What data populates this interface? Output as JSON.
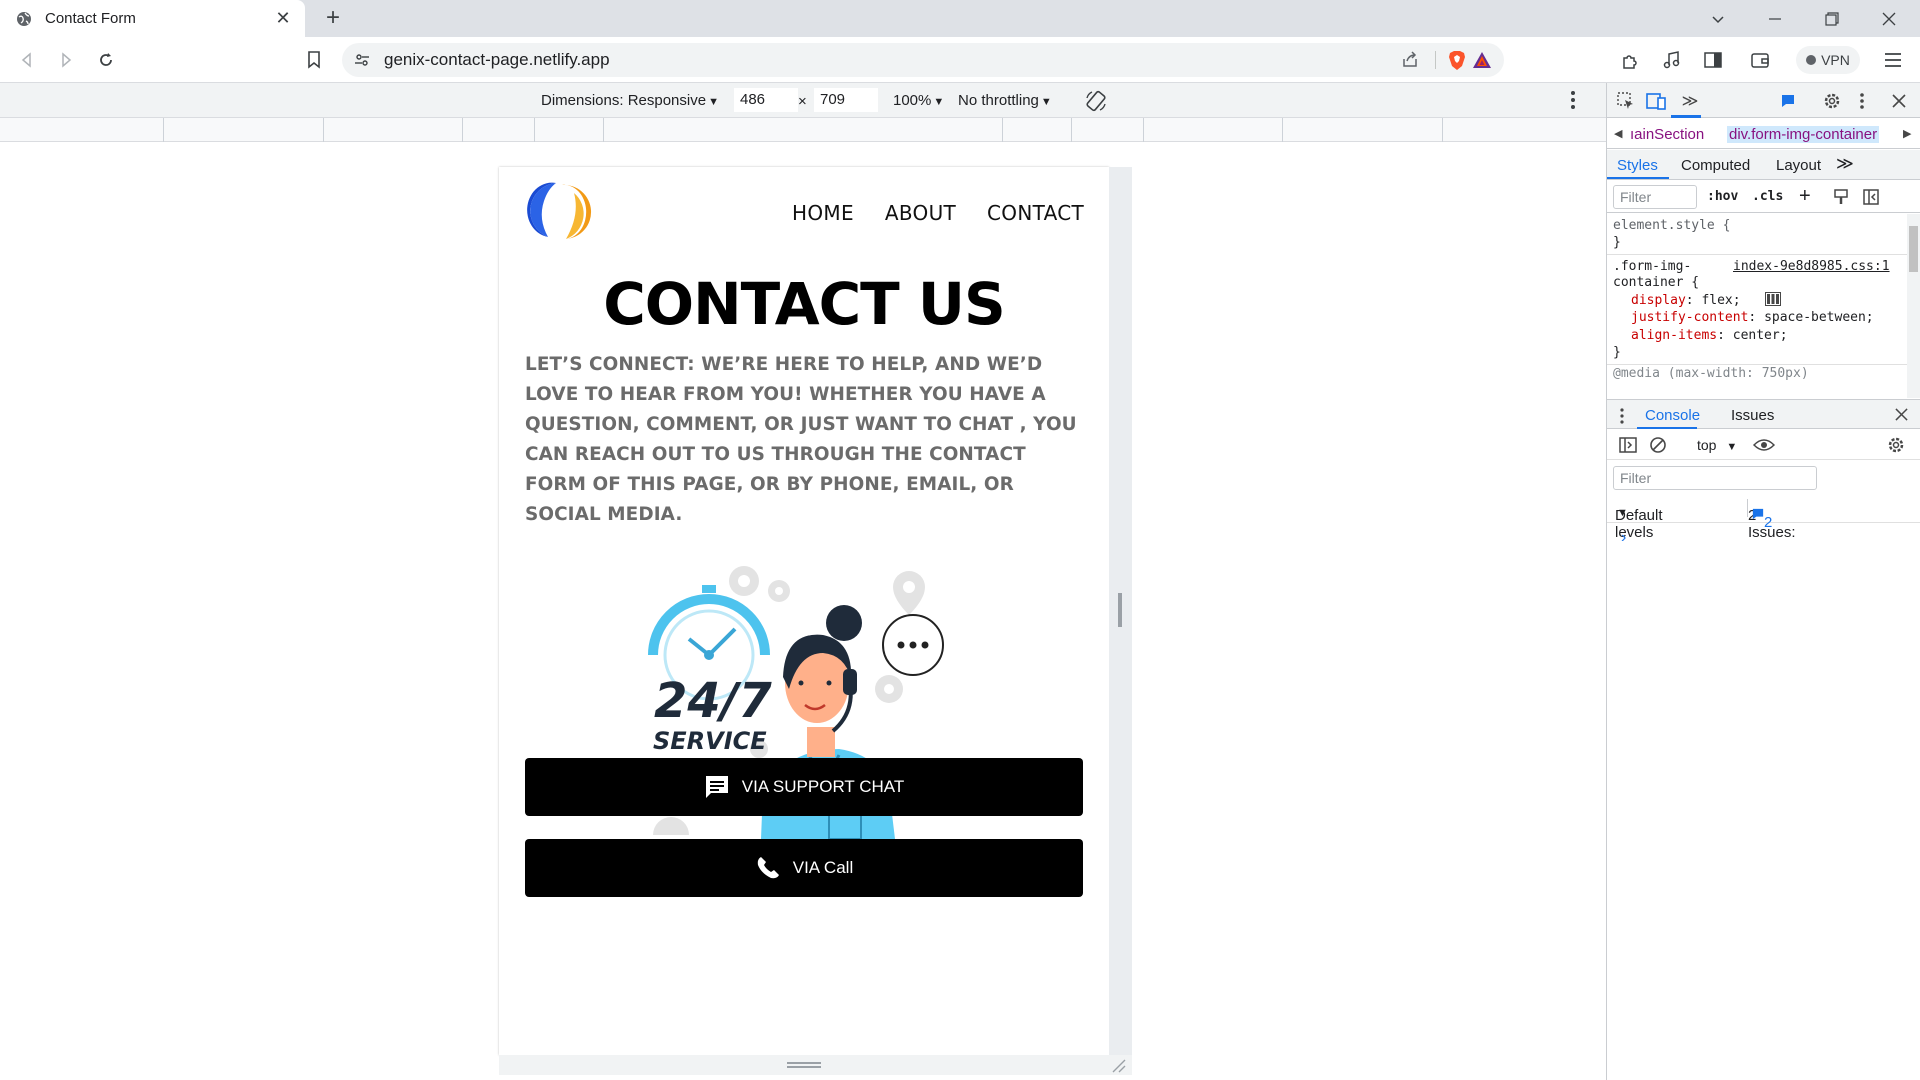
{
  "browser": {
    "tab_title": "Contact Form",
    "tab_close": "✕",
    "new_tab": "+",
    "url": "genix-contact-page.netlify.app",
    "vpn_label": "VPN"
  },
  "device_toolbar": {
    "dimensions_label": "Dimensions: Responsive",
    "width": "486",
    "times": "×",
    "height": "709",
    "zoom": "100%",
    "throttling": "No throttling"
  },
  "page": {
    "nav": [
      "HOME",
      "ABOUT",
      "CONTACT"
    ],
    "heading": "CONTACT US",
    "intro": "LET’S CONNECT: WE’RE HERE TO HELP, AND WE’D LOVE TO HEAR FROM YOU! WHETHER YOU HAVE A QUESTION, COMMENT, OR JUST WANT TO CHAT , YOU CAN REACH OUT TO US THROUGH THE CONTACT FORM OF THIS PAGE, OR BY PHONE, EMAIL, OR SOCIAL MEDIA.",
    "illustration": {
      "big_text": "24/7",
      "sub_text": "SERVICE"
    },
    "buttons": {
      "support_chat": "VIA SUPPORT CHAT",
      "call": "VIA Call"
    }
  },
  "devtools": {
    "breadcrumbs": [
      "ıainSection",
      "div.form-img-container"
    ],
    "subtabs": [
      "Styles",
      "Computed",
      "Layout"
    ],
    "filter_placeholder": "Filter",
    "hov": ":hov",
    "cls": ".cls",
    "styles": {
      "element_style": "element.style {",
      "close_brace": "}",
      "selector_line1": ".form-img-",
      "selector_line2": "container {",
      "source_link": "index-9e8d8985.css:1",
      "props": [
        {
          "name": "display",
          "value": "flex;"
        },
        {
          "name": "justify-content",
          "value": "space-between;"
        },
        {
          "name": "align-items",
          "value": "center;"
        }
      ],
      "media_line": "@media (max-width: 750px)"
    },
    "console_tabs": [
      "Console",
      "Issues"
    ],
    "context": "top",
    "console_filter": "Filter",
    "default_levels": "Default levels",
    "issues_label": "2 Issues:",
    "issues_count": "2",
    "prompt": "›"
  },
  "colors": {
    "accent_blue": "#1a73e8",
    "button_bg": "#000000",
    "intro_text": "#6b6b6b",
    "illus_cyan": "#5dcdf5"
  }
}
